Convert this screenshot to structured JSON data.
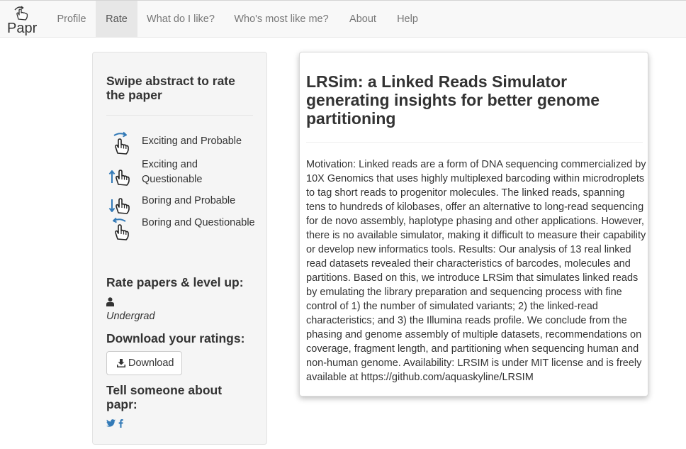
{
  "app": {
    "brand": "Papr"
  },
  "nav": {
    "items": [
      {
        "label": "Profile"
      },
      {
        "label": "Rate"
      },
      {
        "label": "What do I like?"
      },
      {
        "label": "Who's most like me?"
      },
      {
        "label": "About"
      },
      {
        "label": "Help"
      }
    ],
    "active": "Rate"
  },
  "sidebar": {
    "title": "Swipe abstract to rate the paper",
    "legend": [
      {
        "label": "Exciting and Probable",
        "icon": "swipe-right-icon"
      },
      {
        "label": "Exciting and Questionable",
        "icon": "swipe-up-icon"
      },
      {
        "label": "Boring and Probable",
        "icon": "swipe-down-icon"
      },
      {
        "label": "Boring and Questionable",
        "icon": "swipe-left-icon"
      }
    ],
    "level_heading": "Rate papers & level up:",
    "level": "Undergrad",
    "download_heading": "Download your ratings:",
    "download_label": "Download",
    "share_heading": "Tell someone about papr:",
    "share_icons": [
      "twitter-icon",
      "facebook-icon"
    ]
  },
  "paper": {
    "title": "LRSim: a Linked Reads Simulator generating insights for better genome partitioning",
    "abstract": "Motivation: Linked reads are a form of DNA sequencing commercialized by 10X Genomics that uses highly multiplexed barcoding within microdroplets to tag short reads to progenitor molecules. The linked reads, spanning tens to hundreds of kilobases, offer an alternative to long-read sequencing for de novo assembly, haplotype phasing and other applications. However, there is no available simulator, making it difficult to measure their capability or develop new informatics tools. Results: Our analysis of 13 real linked read datasets revealed their characteristics of barcodes, molecules and partitions. Based on this, we introduce LRSim that simulates linked reads by emulating the library preparation and sequencing process with fine control of 1) the number of simulated variants; 2) the linked-read characteristics; and 3) the Illumina reads profile. We conclude from the phasing and genome assembly of multiple datasets, recommendations on coverage, fragment length, and partitioning when sequencing human and non-human genome. Availability: LRSIM is under MIT license and is freely available at https://github.com/aquaskyline/LRSIM"
  },
  "colors": {
    "accent": "#337ab7",
    "navbar_bg": "#f8f8f8",
    "nav_active_bg": "#e7e7e7",
    "sidebar_bg": "#f5f5f5"
  }
}
